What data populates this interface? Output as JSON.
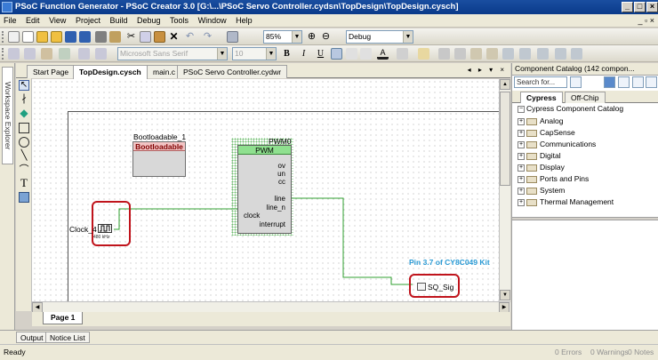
{
  "window": {
    "title": "PSoC Function Generator - PSoC Creator 3.0  [G:\\...\\PSoC Servo Controller.cydsn\\TopDesign\\TopDesign.cysch]",
    "minimize": "_",
    "maximize": "□",
    "close": "×"
  },
  "menu": [
    "File",
    "Edit",
    "View",
    "Project",
    "Build",
    "Debug",
    "Tools",
    "Window",
    "Help"
  ],
  "toolbar": {
    "zoom": "85%",
    "config": "Debug",
    "font": "Microsoft Sans Serif",
    "font_size": "10",
    "bold": "B",
    "italic": "I",
    "underline": "U"
  },
  "left_panel": {
    "workspace_explorer": "Workspace Explorer"
  },
  "doc_tabs": [
    "Start Page",
    "TopDesign.cysch",
    "main.c",
    "PSoC Servo Controller.cydwr"
  ],
  "doc_tab_controls": "◂ ▸ ▾ ×",
  "schematic": {
    "bootloadable": {
      "instance": "Bootloadable_1",
      "type": "Bootloadable"
    },
    "pwm": {
      "instance": "PWM0",
      "type": "PWM",
      "outputs": [
        "ov",
        "un",
        "cc",
        "line",
        "line_n",
        "interrupt"
      ],
      "input": "clock"
    },
    "clock": {
      "instance": "Clock_4",
      "freq": "480 kHz"
    },
    "kit_label": "Pin 3.7 of CY8C049 Kit",
    "pin": {
      "name": "SQ_Sig"
    }
  },
  "page_tab": "Page 1",
  "catalog": {
    "title": "Component Catalog (142 compon...",
    "search_placeholder": "Search for...",
    "tabs": [
      "Cypress",
      "Off-Chip"
    ],
    "root": "Cypress Component Catalog",
    "items": [
      "Analog",
      "CapSense",
      "Communications",
      "Digital",
      "Display",
      "Ports and Pins",
      "System",
      "Thermal Management"
    ]
  },
  "bottom_tabs": [
    "Output",
    "Notice List"
  ],
  "status": {
    "ready": "Ready",
    "errors": "0 Errors",
    "warnings": "0 Warnings",
    "notes": "0 Notes"
  }
}
